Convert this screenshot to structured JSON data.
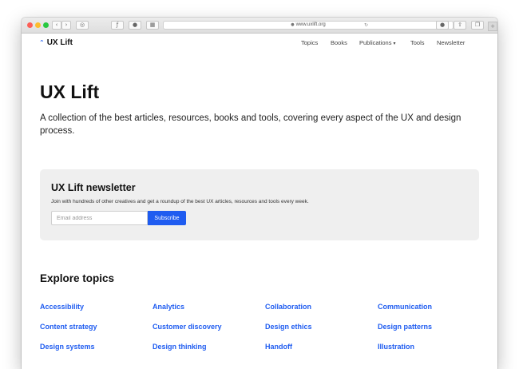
{
  "browser": {
    "address": "www.uxlift.org",
    "icons": [
      "back-icon",
      "forward-icon",
      "reader-icon",
      "bookmark-icon",
      "privacy-icon",
      "extension-icon",
      "lock-icon",
      "reload-icon",
      "download-icon",
      "share-icon",
      "tabs-icon"
    ]
  },
  "site": {
    "logo": "UX Lift",
    "nav": {
      "topics": "Topics",
      "books": "Books",
      "publications": "Publications",
      "tools": "Tools",
      "newsletter": "Newsletter"
    }
  },
  "hero": {
    "title": "UX Lift",
    "description": "A collection of the best articles, resources, books and tools, covering every aspect of the UX and design process."
  },
  "newsletter": {
    "title": "UX Lift newsletter",
    "text": "Join with hundreds of other creatives and get a roundup of the best UX articles, resources and tools every week.",
    "email_placeholder": "Email address",
    "subscribe_label": "Subscribe"
  },
  "topics": {
    "heading": "Explore topics",
    "items": [
      "Accessibility",
      "Analytics",
      "Collaboration",
      "Communication",
      "Content strategy",
      "Customer discovery",
      "Design ethics",
      "Design patterns",
      "Design systems",
      "Design thinking",
      "Handoff",
      "Illustration"
    ]
  },
  "colors": {
    "accent": "#1f5cf0",
    "panel": "#efefef"
  }
}
